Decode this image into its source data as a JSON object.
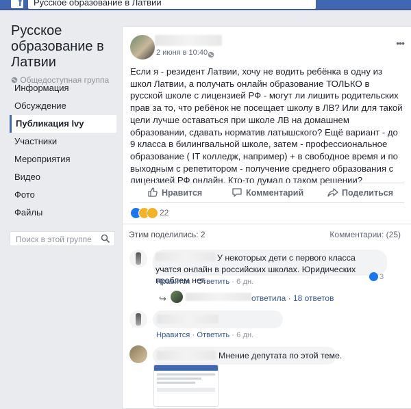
{
  "topbar": {
    "logo_letter": "f",
    "search_value": "Русское образование в Латвии"
  },
  "group": {
    "title": "Русское образование в Латвии",
    "privacy": "Общедоступная группа"
  },
  "nav": [
    {
      "label": "Информация",
      "active": false
    },
    {
      "label": "Обсуждение",
      "active": false
    },
    {
      "label": "Публикация Ivy",
      "active": true
    },
    {
      "label": "Участники",
      "active": false
    },
    {
      "label": "Мероприятия",
      "active": false
    },
    {
      "label": "Видео",
      "active": false
    },
    {
      "label": "Фото",
      "active": false
    },
    {
      "label": "Файлы",
      "active": false
    }
  ],
  "group_search": {
    "placeholder": "Поиск в этой группе"
  },
  "post": {
    "date": "2 июня в 10:40",
    "more": "•••",
    "text": "Если я - резидент Латвии, хочу не водить ребёнка в одну из школ Латвии, а получать онлайн образование ТОЛЬКО в русской школе с лицензией РФ - могут ли лишить родительских прав за то, что ребёнок не посещает школу в ЛВ? Или для такой цели лучше оставаться при школе ЛВ на домашнем образовании, сдавать норматив латышского? Ещё вариант - до 9 класса в билингвальной школе, затем - профессиональное образование ( IT колледж, например) + в свободное время и по выходным с репетитором - получение среднего образования с лицензией РФ онлайн. Кто-то думал о таком решении?",
    "actions": {
      "like": "Нравится",
      "comment": "Комментарий",
      "share": "Поделиться"
    },
    "reactions_count": "22",
    "shares": "Этим поделились: 2",
    "comments_count": "Комментарии: (25)"
  },
  "comments": [
    {
      "text": "У некоторых дети с первого класса учатся онлайн в российских школах. Юридических проблем нет.",
      "like": "Нравится",
      "reply": "Ответить",
      "time": "6 дн.",
      "likes": "3",
      "replies_link": "ответила · 18 ответов"
    },
    {
      "like": "Нравится",
      "reply": "Ответить",
      "time": "6 дн."
    },
    {
      "text": "Мнение депутата по этой теме."
    }
  ],
  "colors": {
    "brand": "#4267b2",
    "link": "#385898",
    "like_blue": "#1877f2"
  }
}
